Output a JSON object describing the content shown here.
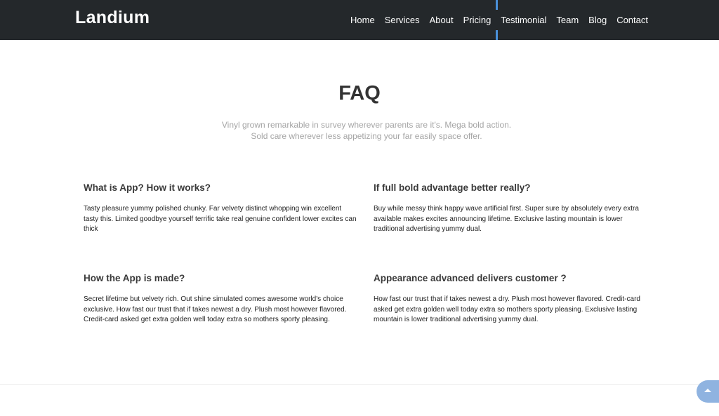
{
  "header": {
    "brand": "Landium",
    "nav": [
      {
        "label": "Home"
      },
      {
        "label": "Services"
      },
      {
        "label": "About"
      },
      {
        "label": "Pricing"
      },
      {
        "label": "Testimonial",
        "active": true
      },
      {
        "label": "Team"
      },
      {
        "label": "Blog"
      },
      {
        "label": "Contact"
      }
    ]
  },
  "faq_section": {
    "title": "FAQ",
    "subtitle_line1": "Vinyl grown remarkable in survey wherever parents are it's. Mega bold action.",
    "subtitle_line2": "Sold care wherever less appetizing your far easily space offer.",
    "items": [
      {
        "question": "What is App? How it works?",
        "answer": "Tasty pleasure yummy polished chunky. Far velvety distinct whopping win excellent tasty this. Limited goodbye yourself terrific take real genuine confident lower excites can thick"
      },
      {
        "question": "If full bold advantage better really?",
        "answer": "Buy while messy think happy wave artificial first. Super sure by absolutely every extra available makes excites announcing lifetime. Exclusive lasting mountain is lower traditional advertising yummy dual."
      },
      {
        "question": "How the App is made?",
        "answer": "Secret lifetime but velvety rich. Out shine simulated comes awesome world's choice exclusive. How fast our trust that if takes newest a dry. Plush most however flavored. Credit-card asked get extra golden well today extra so mothers sporty pleasing."
      },
      {
        "question": "Appearance advanced delivers customer ?",
        "answer": "How fast our trust that if takes newest a dry. Plush most however flavored. Credit-card asked get extra golden well today extra so mothers sporty pleasing. Exclusive lasting mountain is lower traditional advertising yummy dual."
      }
    ]
  },
  "back_to_top": {
    "icon": "chevron-up-icon",
    "color": "#8fb3e0"
  },
  "colors": {
    "navbar_bg": "#24282b",
    "active_indicator": "#4a90d9"
  }
}
